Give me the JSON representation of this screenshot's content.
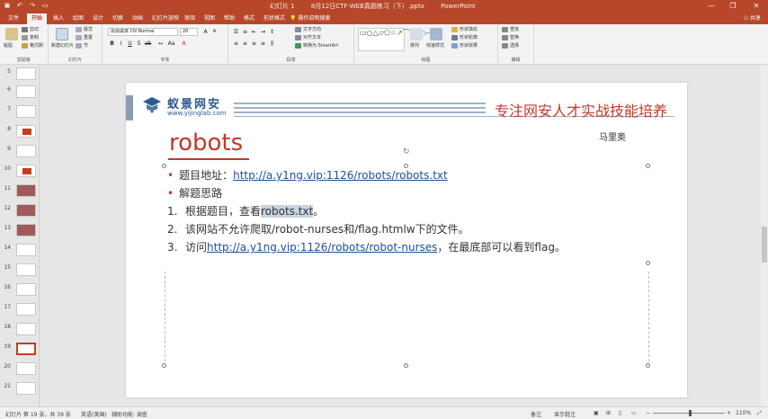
{
  "titlebar": {
    "doc_label": "幻灯片 1",
    "file_name": "8月12日CTF-WEB真题练习（下）.pptx",
    "app_name": "PowerPoint",
    "minimize": "—",
    "restore": "❐",
    "close": "✕"
  },
  "tabs": [
    "文件",
    "开始",
    "插入",
    "绘图",
    "设计",
    "切换",
    "动画",
    "幻灯片放映",
    "审阅",
    "视图",
    "帮助",
    "格式",
    "形状格式"
  ],
  "active_tab": "开始",
  "tellme": "操作说明搜索",
  "share": "共享",
  "ribbon": {
    "clipboard": {
      "label": "剪贴板",
      "paste": "粘贴",
      "cut": "剪切",
      "copy": "复制",
      "painter": "格式刷"
    },
    "slides": {
      "label": "幻灯片",
      "new": "新建幻灯片",
      "layout": "版式",
      "reset": "重置",
      "section": "节"
    },
    "font": {
      "label": "字体",
      "name": "思源黑体 CN Normal",
      "size": "20"
    },
    "paragraph": {
      "label": "段落",
      "text_dir": "文字方向",
      "align_text": "对齐文本",
      "smartart": "转换为 SmartArt"
    },
    "drawing": {
      "label": "绘图",
      "arrange": "排列",
      "quick_styles": "快速样式",
      "fill": "形状填充",
      "outline": "形状轮廓",
      "effects": "形状效果"
    },
    "editing": {
      "label": "编辑",
      "find": "查找",
      "replace": "替换",
      "select": "选择"
    }
  },
  "thumbnails": [
    {
      "num": "5"
    },
    {
      "num": "6"
    },
    {
      "num": "7"
    },
    {
      "num": "8"
    },
    {
      "num": "9"
    },
    {
      "num": "10"
    },
    {
      "num": "11"
    },
    {
      "num": "12"
    },
    {
      "num": "13"
    },
    {
      "num": "14"
    },
    {
      "num": "15"
    },
    {
      "num": "16"
    },
    {
      "num": "17"
    },
    {
      "num": "18"
    },
    {
      "num": "19"
    },
    {
      "num": "20"
    },
    {
      "num": "21"
    }
  ],
  "selected_thumb": "19",
  "slide": {
    "logo_name": "蚁景网安",
    "logo_url": "www.yijinglab.com",
    "slogan": "专注网安人才实战技能培养",
    "author": "马里奥",
    "title": "robots",
    "bullet1_prefix": "题目地址：",
    "bullet1_link": "http://a.y1ng.vip:1126/robots/robots.txt",
    "bullet2": "解题思路",
    "step1_num": "1.",
    "step1_pre": "根据题目，查看",
    "step1_hl": "robots.txt",
    "step1_post": "。",
    "step2_num": "2.",
    "step2_text": "该网站不允许爬取/robot-nurses和/flag.htmlw下的文件。",
    "step3_num": "3.",
    "step3_pre": "访问",
    "step3_link": "http://a.y1ng.vip:1126/robots/robot-nurses",
    "step3_post": "，在最底部可以看到flag。"
  },
  "status": {
    "slide_info": "幻灯片 第 19 张，共 39 张",
    "lang": "英语(美国)",
    "accessibility": "辅助功能: 调查",
    "notes": "备注",
    "comments": "显示批注",
    "zoom": "110%",
    "zoom_level_pct": 110
  },
  "colors": {
    "brand": "#b7472a",
    "title_red": "#c0392b",
    "link_blue": "#1f4e9c"
  }
}
